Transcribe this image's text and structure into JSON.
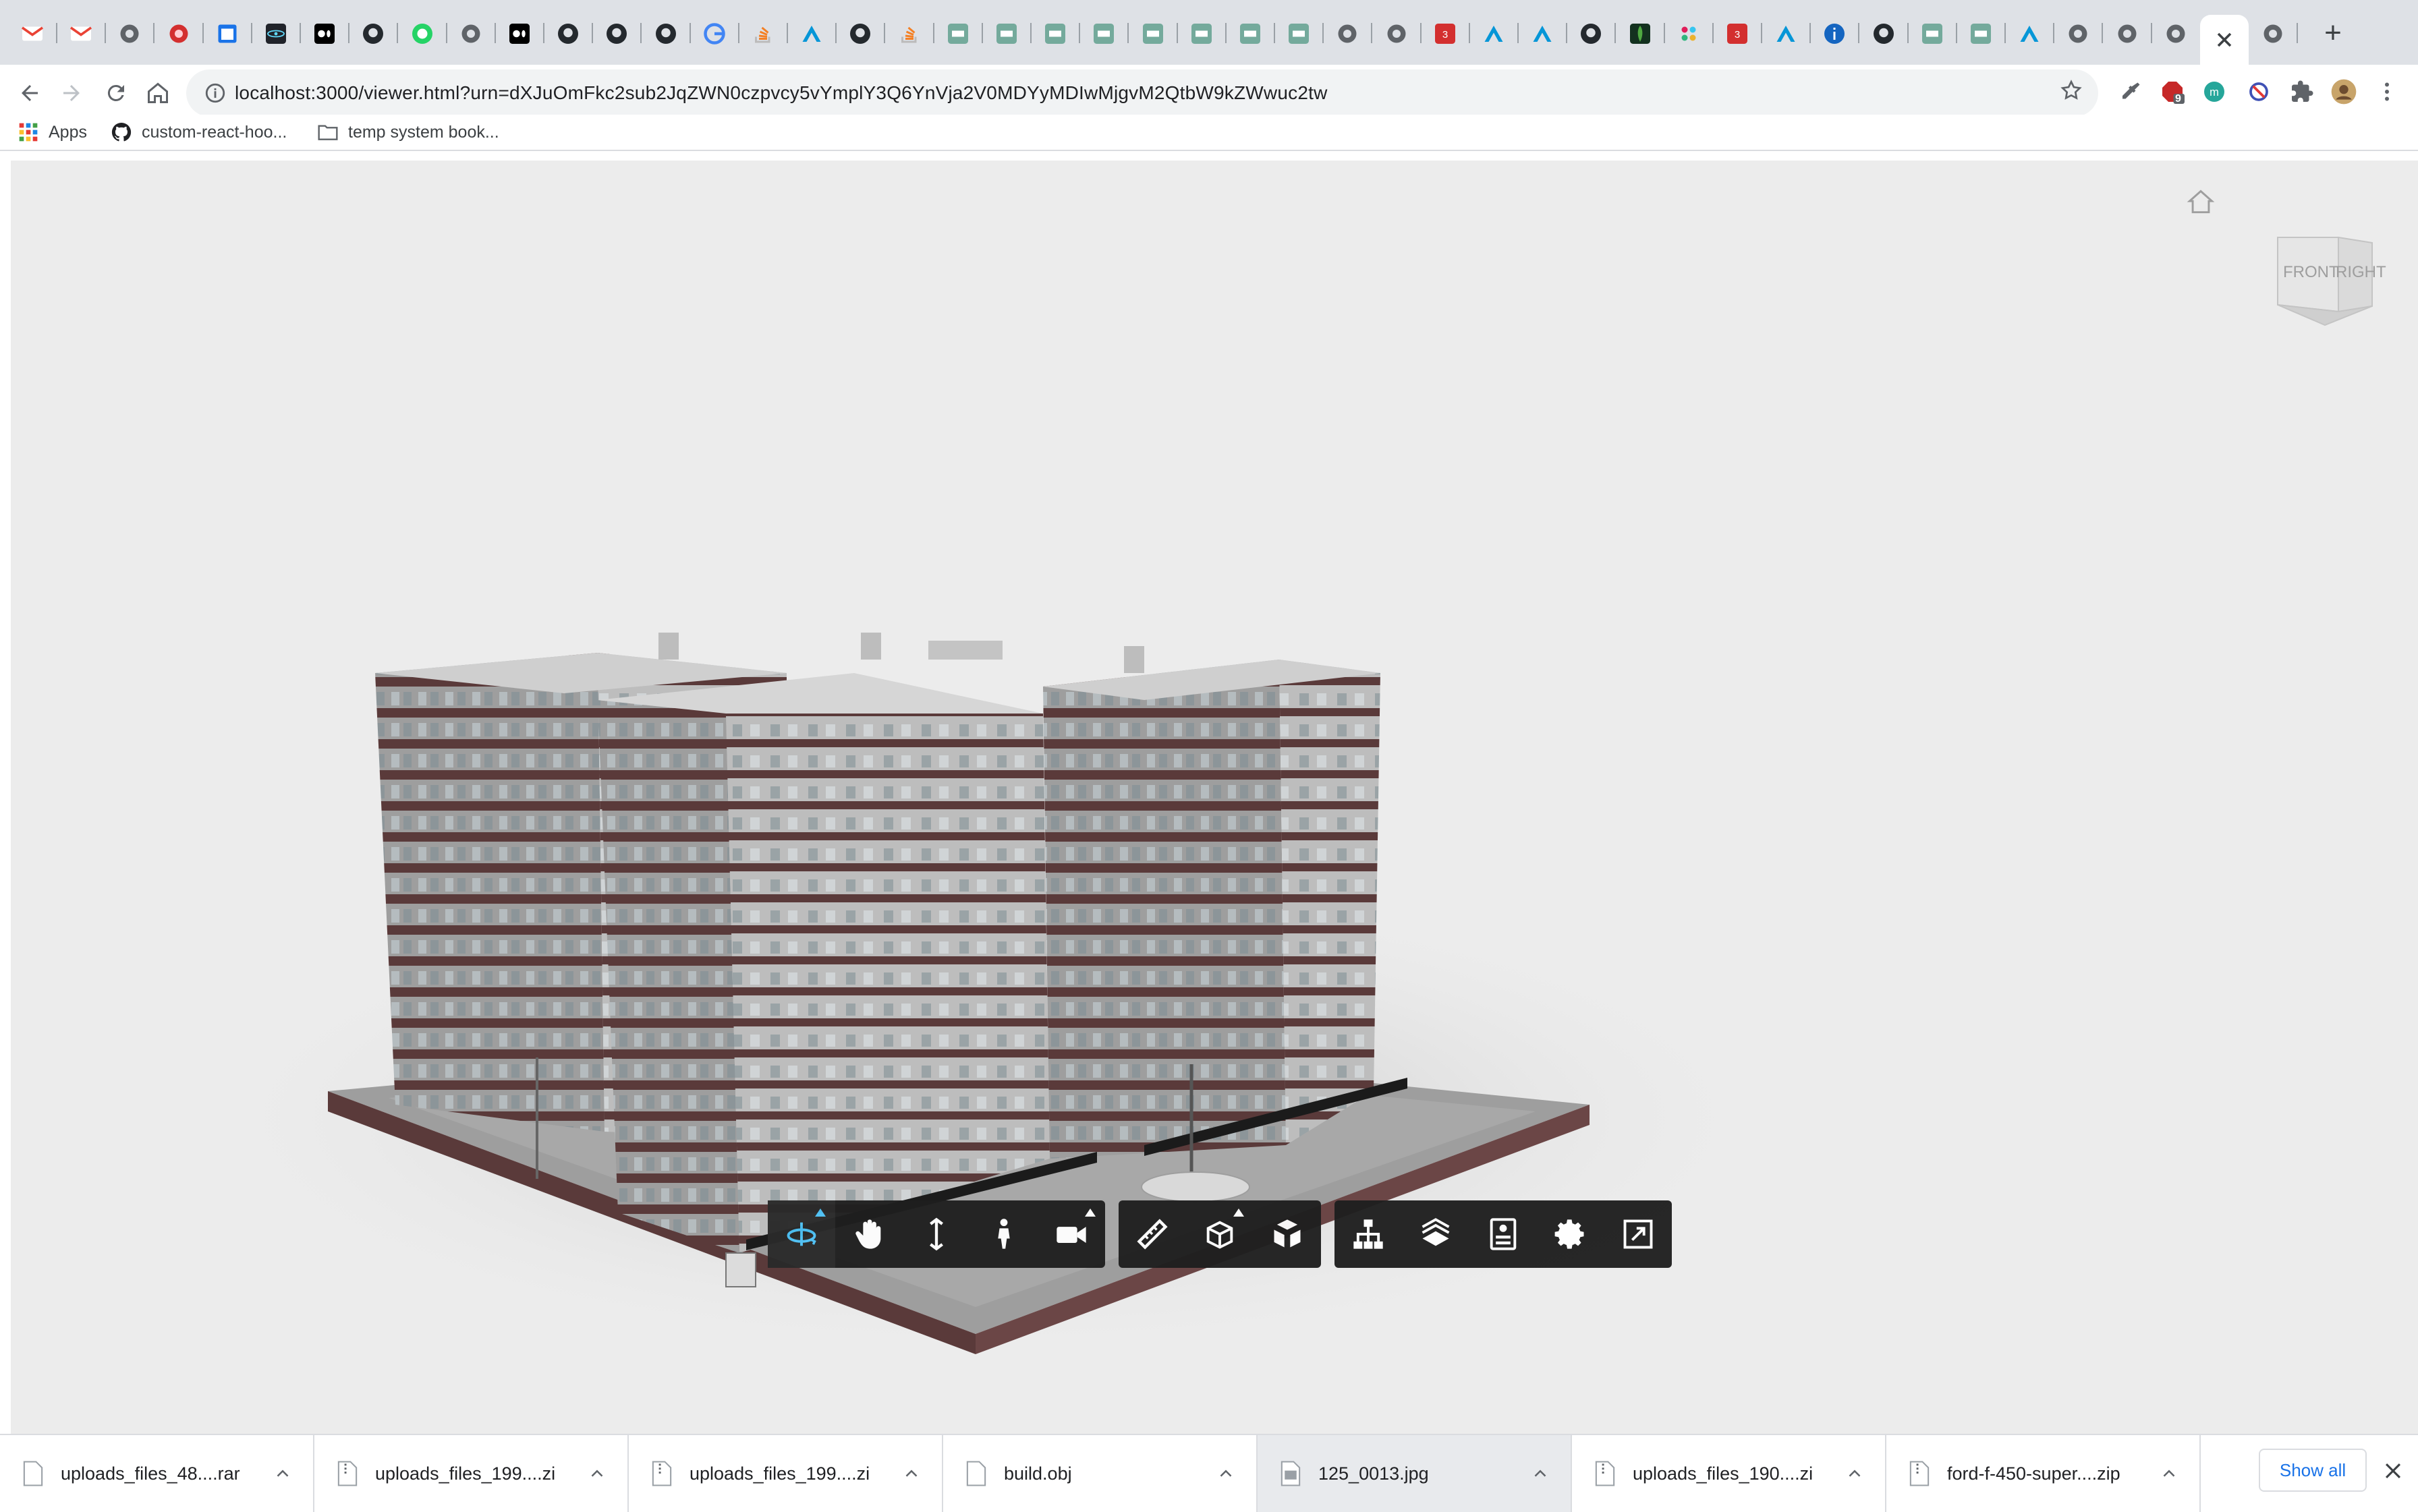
{
  "browser": {
    "tabs": [
      {
        "icon": "gmail-icon"
      },
      {
        "icon": "gmail-icon"
      },
      {
        "icon": "globe-icon"
      },
      {
        "icon": "record-icon"
      },
      {
        "icon": "calendar-icon"
      },
      {
        "icon": "react-icon"
      },
      {
        "icon": "medium-icon"
      },
      {
        "icon": "github-icon"
      },
      {
        "icon": "whatsapp-icon"
      },
      {
        "icon": "globe-icon"
      },
      {
        "icon": "medium-icon"
      },
      {
        "icon": "github-icon"
      },
      {
        "icon": "github-icon"
      },
      {
        "icon": "github-icon"
      },
      {
        "icon": "google-icon"
      },
      {
        "icon": "stackoverflow-icon"
      },
      {
        "icon": "autodesk-icon"
      },
      {
        "icon": "github-icon"
      },
      {
        "icon": "stackoverflow-icon"
      },
      {
        "icon": "chatgpt-icon"
      },
      {
        "icon": "chatgpt-icon"
      },
      {
        "icon": "chatgpt-icon"
      },
      {
        "icon": "chatgpt-icon"
      },
      {
        "icon": "chatgpt-icon"
      },
      {
        "icon": "chatgpt-icon"
      },
      {
        "icon": "chatgpt-icon"
      },
      {
        "icon": "chatgpt-icon"
      },
      {
        "icon": "globe-icon"
      },
      {
        "icon": "globe-icon"
      },
      {
        "icon": "threejs-icon"
      },
      {
        "icon": "autodesk-icon"
      },
      {
        "icon": "autodesk-icon"
      },
      {
        "icon": "github-icon"
      },
      {
        "icon": "mongodb-icon"
      },
      {
        "icon": "slack-icon"
      },
      {
        "icon": "threejs-icon"
      },
      {
        "icon": "autodesk-icon"
      },
      {
        "icon": "info-icon"
      },
      {
        "icon": "github-icon"
      },
      {
        "icon": "chatgpt-icon"
      },
      {
        "icon": "chatgpt-icon"
      },
      {
        "icon": "autodesk-icon"
      },
      {
        "icon": "globe-icon"
      },
      {
        "icon": "globe-icon"
      },
      {
        "icon": "globe-icon"
      },
      {
        "icon": "close-icon",
        "active": true
      },
      {
        "icon": "globe-icon"
      }
    ],
    "url_host": "localhost",
    "url_rest": ":3000/viewer.html?urn=dXJuOmFkc2sub2JqZWN0czpvcy5vYmplY3Q6YnVja2V0MDYyMDIwMjgvM2QtbW9kZWwuc2tw",
    "bookmarks": [
      {
        "icon": "apps-grid-icon",
        "label": "Apps"
      },
      {
        "icon": "github-icon",
        "label": "custom-react-hoo..."
      },
      {
        "icon": "folder-icon",
        "label": "temp system book..."
      }
    ],
    "extension_badge": "9"
  },
  "viewer": {
    "viewcube": {
      "front": "FRONT",
      "right": "RIGHT"
    },
    "toolbar_groups": [
      [
        "orbit-icon",
        "pan-hand-icon",
        "zoom-icon",
        "first-person-icon",
        "camera-icon"
      ],
      [
        "measure-icon",
        "section-icon",
        "explode-icon"
      ],
      [
        "model-browser-icon",
        "layers-icon",
        "properties-icon",
        "settings-icon",
        "fullscreen-icon"
      ]
    ]
  },
  "downloads": {
    "items": [
      {
        "name": "uploads_files_48....rar",
        "icon": "file-icon"
      },
      {
        "name": "uploads_files_199....zi",
        "icon": "zip-file-icon"
      },
      {
        "name": "uploads_files_199....zi",
        "icon": "zip-file-icon"
      },
      {
        "name": "build.obj",
        "icon": "file-icon"
      },
      {
        "name": "125_0013.jpg",
        "icon": "image-file-icon",
        "selected": true
      },
      {
        "name": "uploads_files_190....zi",
        "icon": "zip-file-icon"
      },
      {
        "name": "ford-f-450-super....zip",
        "icon": "zip-file-icon"
      }
    ],
    "show_all": "Show all"
  }
}
